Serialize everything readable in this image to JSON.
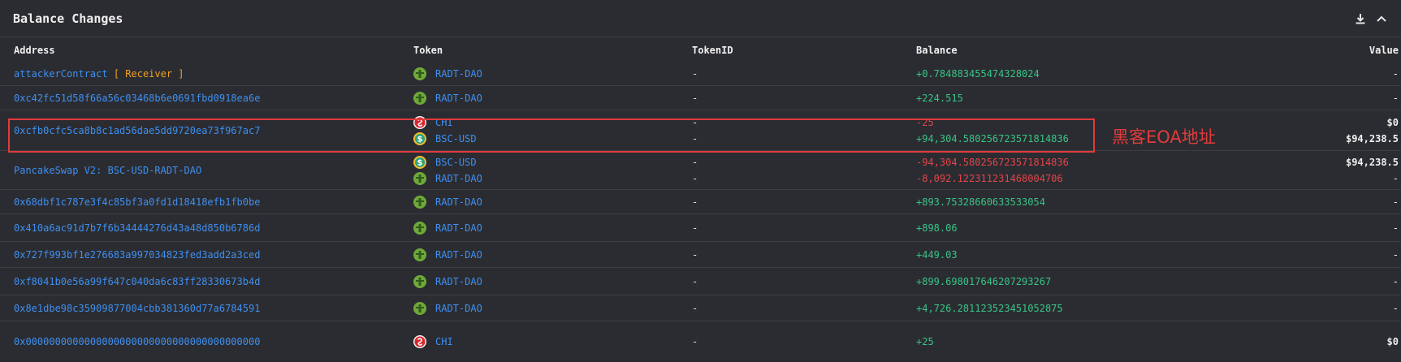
{
  "panel": {
    "title": "Balance Changes"
  },
  "columns": {
    "address": "Address",
    "token": "Token",
    "token_id": "TokenID",
    "balance": "Balance",
    "value": "Value"
  },
  "annotation": "黑客EOA地址",
  "rows": [
    {
      "address": "attackerContract",
      "tag": "[ Receiver ]",
      "entries": [
        {
          "icon": "radt-dao-icon",
          "token": "RADT-DAO",
          "token_id": "-",
          "balance": "+0.784883455474328024",
          "sign": "pos",
          "value": "-"
        }
      ]
    },
    {
      "address": "0xc42fc51d58f66a56c03468b6e0691fbd0918ea6e",
      "tag": "",
      "entries": [
        {
          "icon": "radt-dao-icon",
          "token": "RADT-DAO",
          "token_id": "-",
          "balance": "+224.515",
          "sign": "pos",
          "value": "-"
        }
      ]
    },
    {
      "address": "0xcfb0cfc5ca8b8c1ad56dae5dd9720ea73f967ac7",
      "tag": "",
      "entries": [
        {
          "icon": "chi-icon",
          "token": "CHI",
          "token_id": "-",
          "balance": "-25",
          "sign": "neg",
          "value": "$0"
        },
        {
          "icon": "bsc-usd-icon",
          "token": "BSC-USD",
          "token_id": "-",
          "balance": "+94,304.580256723571814836",
          "sign": "pos",
          "value": "$94,238.5"
        }
      ]
    },
    {
      "address": "PancakeSwap V2: BSC-USD-RADT-DAO",
      "tag": "",
      "entries": [
        {
          "icon": "bsc-usd-icon",
          "token": "BSC-USD",
          "token_id": "-",
          "balance": "-94,304.580256723571814836",
          "sign": "neg",
          "value": "$94,238.5"
        },
        {
          "icon": "radt-dao-icon",
          "token": "RADT-DAO",
          "token_id": "-",
          "balance": "-8,092.122311231468004706",
          "sign": "neg",
          "value": "-"
        }
      ]
    },
    {
      "address": "0x68dbf1c787e3f4c85bf3a0fd1d18418efb1fb0be",
      "tag": "",
      "entries": [
        {
          "icon": "radt-dao-icon",
          "token": "RADT-DAO",
          "token_id": "-",
          "balance": "+893.75328660633533054",
          "sign": "pos",
          "value": "-"
        }
      ]
    },
    {
      "address": "0x410a6ac91d7b7f6b34444276d43a48d850b6786d",
      "tag": "",
      "entries": [
        {
          "icon": "radt-dao-icon",
          "token": "RADT-DAO",
          "token_id": "-",
          "balance": "+898.06",
          "sign": "pos",
          "value": "-"
        }
      ]
    },
    {
      "address": "0x727f993bf1e276683a997034823fed3add2a3ced",
      "tag": "",
      "entries": [
        {
          "icon": "radt-dao-icon",
          "token": "RADT-DAO",
          "token_id": "-",
          "balance": "+449.03",
          "sign": "pos",
          "value": "-"
        }
      ]
    },
    {
      "address": "0xf8041b0e56a99f647c040da6c83ff28330673b4d",
      "tag": "",
      "entries": [
        {
          "icon": "radt-dao-icon",
          "token": "RADT-DAO",
          "token_id": "-",
          "balance": "+899.698017646207293267",
          "sign": "pos",
          "value": "-"
        }
      ]
    },
    {
      "address": "0x8e1dbe98c35909877004cbb381360d77a6784591",
      "tag": "",
      "entries": [
        {
          "icon": "radt-dao-icon",
          "token": "RADT-DAO",
          "token_id": "-",
          "balance": "+4,726.281123523451052875",
          "sign": "pos",
          "value": "-"
        }
      ]
    },
    {
      "address": "0x0000000000000000000000000000000000000000",
      "tag": "",
      "entries": [
        {
          "icon": "chi-icon",
          "token": "CHI",
          "token_id": "-",
          "balance": "+25",
          "sign": "pos",
          "value": "$0"
        }
      ]
    }
  ]
}
